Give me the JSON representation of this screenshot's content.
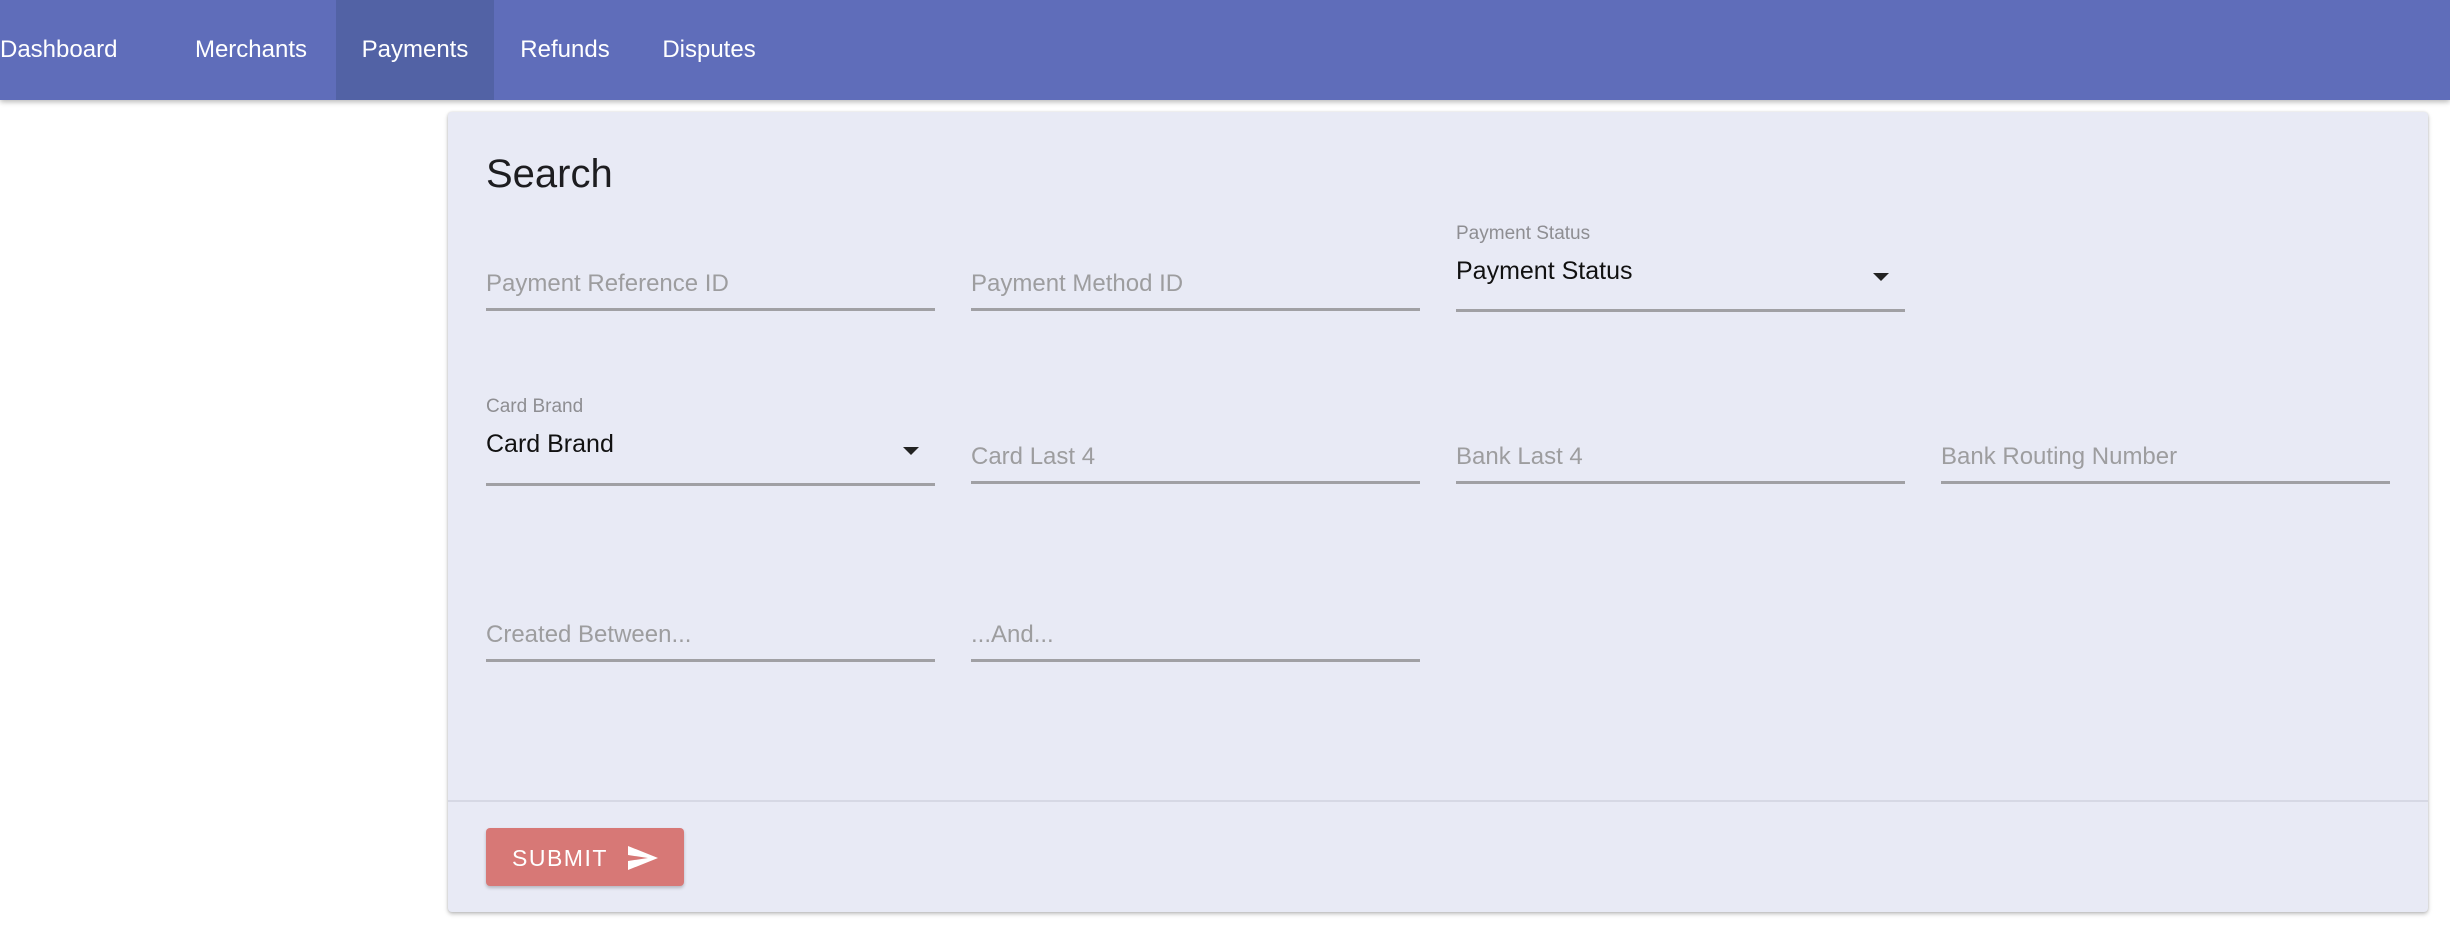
{
  "nav": {
    "items": [
      {
        "label": "Dashboard",
        "active": false
      },
      {
        "label": "Merchants",
        "active": false
      },
      {
        "label": "Payments",
        "active": true
      },
      {
        "label": "Refunds",
        "active": false
      },
      {
        "label": "Disputes",
        "active": false
      }
    ]
  },
  "search": {
    "title": "Search",
    "fields": {
      "payment_reference_id": {
        "placeholder": "Payment Reference ID",
        "value": ""
      },
      "payment_method_id": {
        "placeholder": "Payment Method ID",
        "value": ""
      },
      "payment_status": {
        "label": "Payment Status",
        "selected": "Payment Status",
        "icon": "caret-down-icon"
      },
      "card_brand": {
        "label": "Card Brand",
        "selected": "Card Brand",
        "icon": "caret-down-icon"
      },
      "card_last_4": {
        "placeholder": "Card Last 4",
        "value": ""
      },
      "bank_last_4": {
        "placeholder": "Bank Last 4",
        "value": ""
      },
      "bank_routing_number": {
        "placeholder": "Bank Routing Number",
        "value": ""
      },
      "created_between": {
        "placeholder": "Created Between...",
        "value": ""
      },
      "created_and": {
        "placeholder": "...And...",
        "value": ""
      }
    },
    "submit": {
      "label": "SUBMIT",
      "icon": "send-icon"
    }
  },
  "colors": {
    "nav_bg": "#5f6dba",
    "nav_active_bg": "#5262a5",
    "card_bg": "#e8eaf5",
    "submit_bg": "#d77876"
  }
}
